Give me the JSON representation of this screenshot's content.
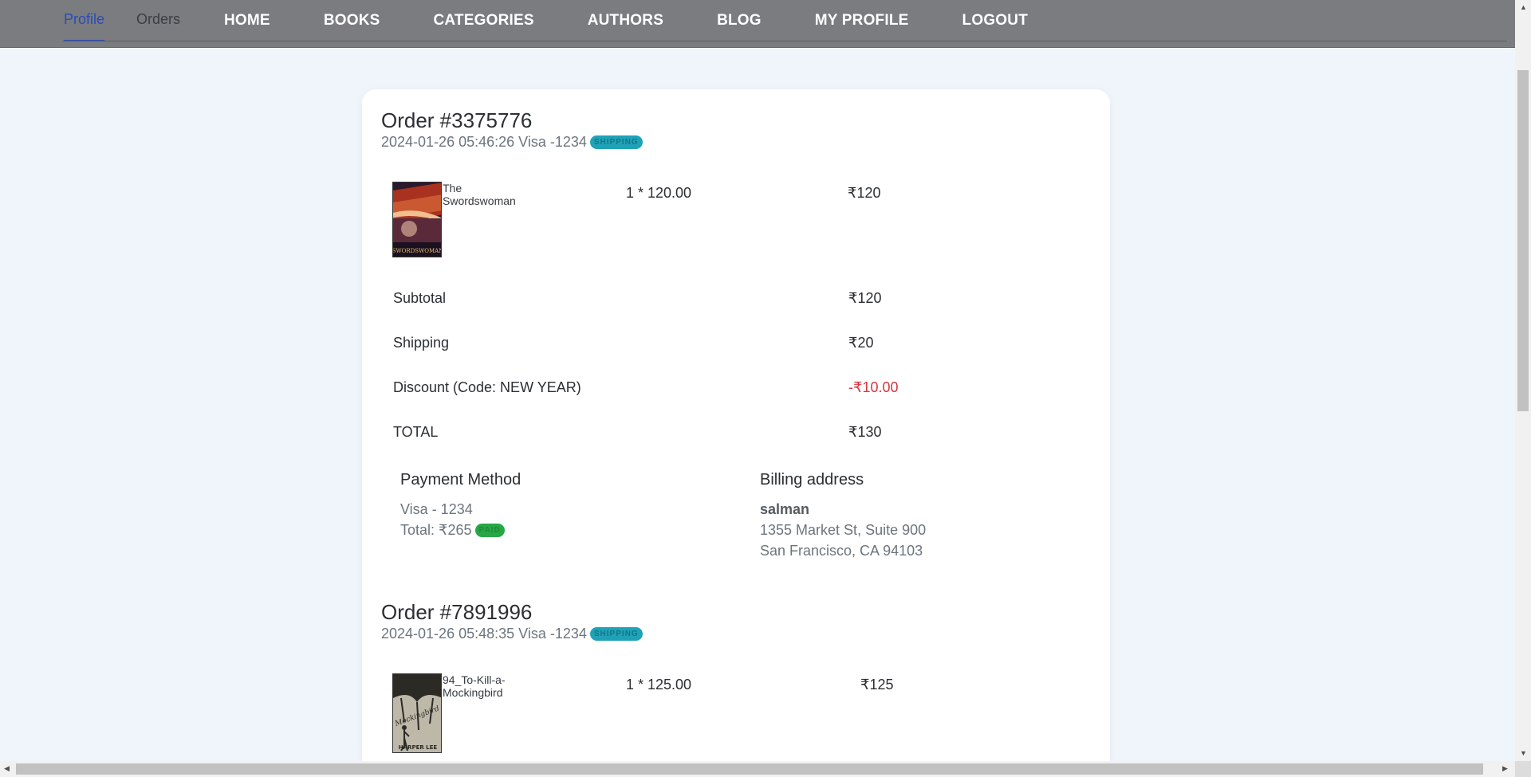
{
  "subtabs": [
    "Profile",
    "Orders"
  ],
  "nav": [
    "HOME",
    "BOOKS",
    "CATEGORIES",
    "AUTHORS",
    "BLOG",
    "MY PROFILE",
    "LOGOUT"
  ],
  "orders": [
    {
      "title": "Order #3375776",
      "meta": "2024-01-26 05:46:26 Visa -1234",
      "status": "SHIPPING",
      "item": {
        "name": "The Swordswoman",
        "qty": "1 * 120.00",
        "price": "₹120",
        "cover_title": "SWORDSWOMAN",
        "cover_colors": [
          "#7a1e1a",
          "#c24a2a",
          "#e8a07a",
          "#2a1a2e"
        ]
      },
      "summary": {
        "subtotal_label": "Subtotal",
        "subtotal": "₹120",
        "shipping_label": "Shipping",
        "shipping": "₹20",
        "discount_label": "Discount (Code: NEW YEAR)",
        "discount": "-₹10.00",
        "total_label": "TOTAL",
        "total": "₹130"
      },
      "payment": {
        "title": "Payment Method",
        "method": "Visa - 1234",
        "total": "Total: ₹265",
        "status": "PAID"
      },
      "billing": {
        "title": "Billing address",
        "name": "salman",
        "line1": "1355 Market St, Suite 900",
        "line2": "San Francisco, CA 94103"
      }
    },
    {
      "title": "Order #7891996",
      "meta": "2024-01-26 05:48:35 Visa -1234",
      "status": "SHIPPING",
      "item": {
        "name": "94_To-Kill-a-Mockingbird",
        "qty": "1 * 125.00",
        "price": "₹125",
        "cover_title": "HARPER LEE",
        "cover_colors": [
          "#2b2a25",
          "#d8d2bf"
        ]
      }
    }
  ]
}
